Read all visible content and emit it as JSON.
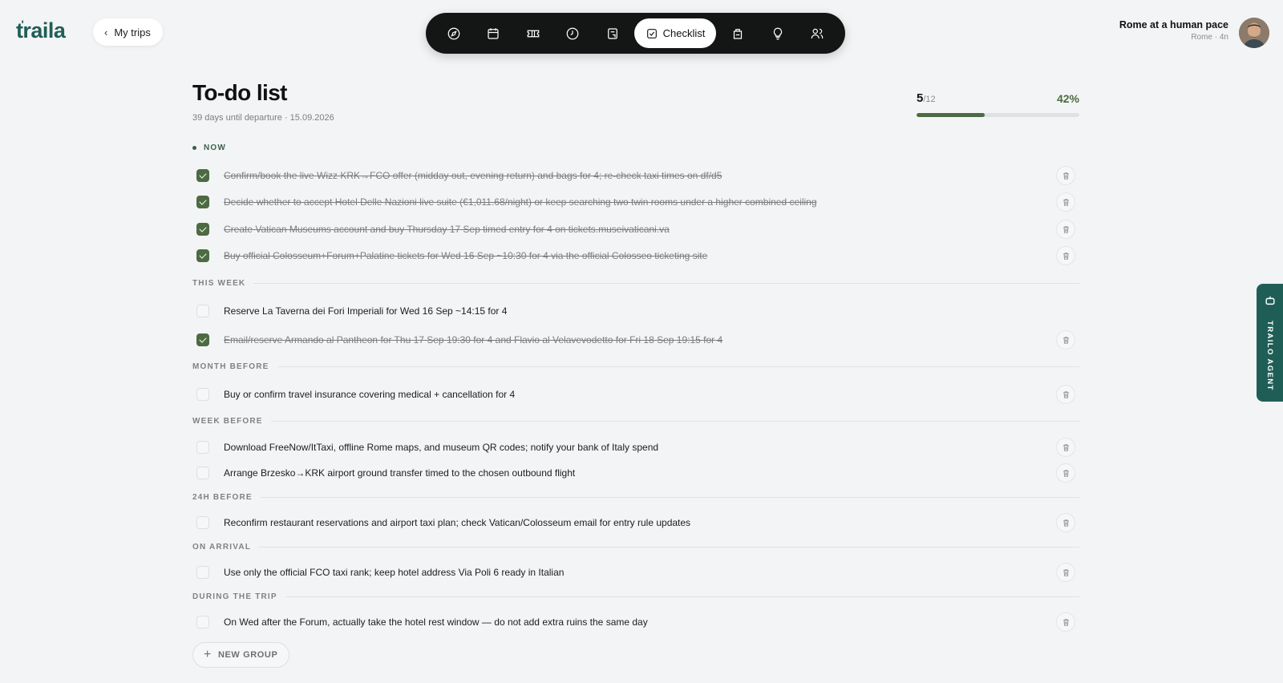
{
  "brand": {
    "name": "traila"
  },
  "header": {
    "back_label": "My trips",
    "active_tab_label": "Checklist",
    "trip_title": "Rome at a human pace",
    "trip_sub": "Rome · 4n"
  },
  "nav": {
    "icons": [
      "compass-icon",
      "calendar-icon",
      "ticket-icon",
      "clock-icon",
      "document-icon",
      "checklist-icon",
      "bag-icon",
      "lightbulb-icon",
      "people-icon"
    ]
  },
  "page": {
    "title": "To-do list",
    "subtitle": "39 days until departure · 15.09.2026"
  },
  "progress": {
    "done": "5",
    "total": "/12",
    "percent_label": "42%",
    "fraction": 0.42
  },
  "groups": {
    "now": "NOW",
    "this_week": "THIS WEEK",
    "month_before": "MONTH BEFORE",
    "week_before": "WEEK BEFORE",
    "h24_before": "24H BEFORE",
    "on_arrival": "ON ARRIVAL",
    "during_trip": "DURING THE TRIP"
  },
  "tasks": [
    {
      "text": "Confirm/book the live Wizz KRK→FCO offer (midday out, evening return) and bags for 4; re-check taxi times on df/d5",
      "done": true
    },
    {
      "text": "Decide whether to accept Hotel Delle Nazioni live suite (€1,011.68/night) or keep searching two twin rooms under a higher combined ceiling",
      "done": true
    },
    {
      "text": "Create Vatican Museums account and buy Thursday 17 Sep timed entry for 4 on tickets.museivaticani.va",
      "done": true
    },
    {
      "text": "Buy official Colosseum+Forum+Palatine tickets for Wed 16 Sep ~10:30 for 4 via the official Colosseo ticketing site",
      "done": true
    },
    {
      "text": "Reserve La Taverna dei Fori Imperiali for Wed 16 Sep ~14:15 for 4",
      "done": false
    },
    {
      "text": "Email/reserve Armando al Pantheon for Thu 17 Sep 19:30 for 4 and Flavio al Velavevodetto for Fri 18 Sep 19:15 for 4",
      "done": true
    },
    {
      "text": "Buy or confirm travel insurance covering medical + cancellation for 4",
      "done": false
    },
    {
      "text": "Download FreeNow/ItTaxi, offline Rome maps, and museum QR codes; notify your bank of Italy spend",
      "done": false
    },
    {
      "text": "Arrange Brzesko→KRK airport ground transfer timed to the chosen outbound flight",
      "done": false
    },
    {
      "text": "Reconfirm restaurant reservations and airport taxi plan; check Vatican/Colosseum email for entry rule updates",
      "done": false
    },
    {
      "text": "Use only the official FCO taxi rank; keep hotel address Via Poli 6 ready in Italian",
      "done": false
    },
    {
      "text": "On Wed after the Forum, actually take the hotel rest window — do not add extra ruins the same day",
      "done": false
    }
  ],
  "new_group_label": "NEW GROUP",
  "agent_label": "TRAILO AGENT",
  "colors": {
    "accent": "#4c6b42",
    "brand": "#1f5e57",
    "nav_bg": "#141616"
  }
}
